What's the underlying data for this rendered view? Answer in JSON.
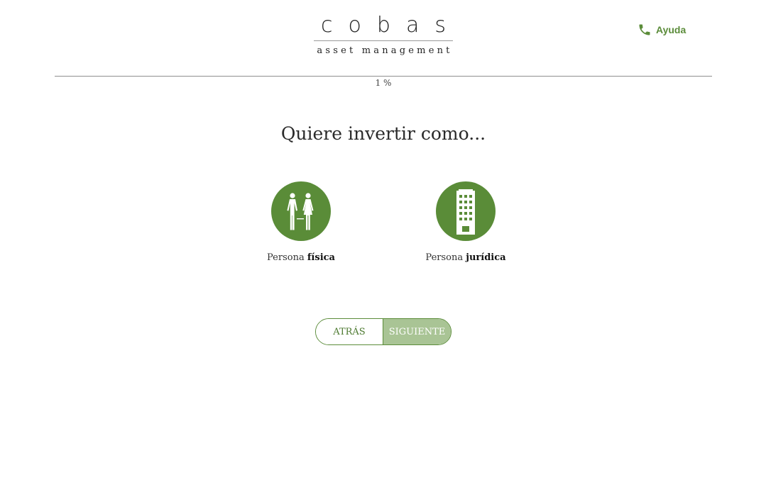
{
  "header": {
    "logo_word": "cobas",
    "logo_sub": "asset management",
    "help_label": "Ayuda",
    "help_icon": "phone-icon"
  },
  "progress": {
    "text": "1 %",
    "value_percent": 1
  },
  "question": "Quiere invertir como...",
  "options": [
    {
      "prefix": "Persona",
      "emphasis": "física",
      "icon": "people-icon"
    },
    {
      "prefix": "Persona",
      "emphasis": "jurídica",
      "icon": "building-icon"
    }
  ],
  "buttons": {
    "back_label": "ATRÁS",
    "next_label": "SIGUIENTE"
  },
  "colors": {
    "brand_green": "#5a8c38",
    "next_disabled": "#a9c495",
    "divider": "#8f8f8f"
  }
}
